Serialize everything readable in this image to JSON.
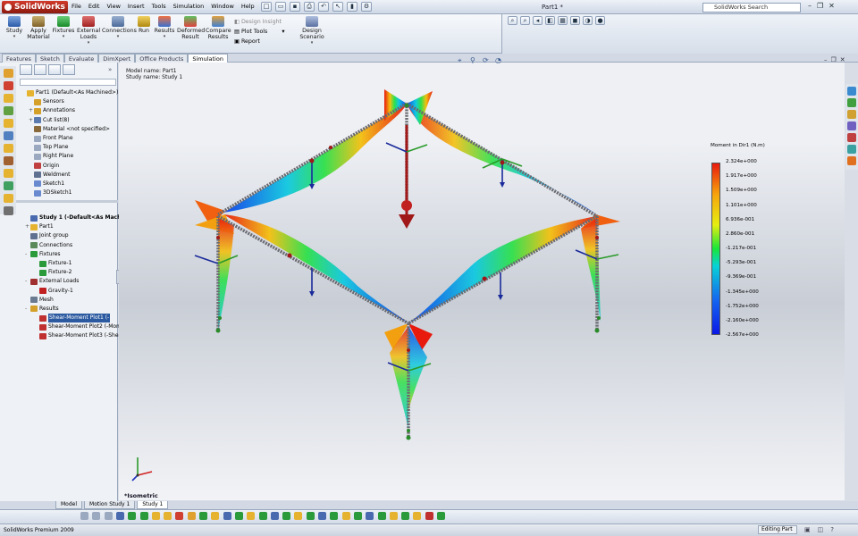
{
  "app": {
    "logo": "SolidWorks",
    "document_title": "Part1 *",
    "search_placeholder": "SolidWorks Search"
  },
  "menu": [
    "File",
    "Edit",
    "View",
    "Insert",
    "Tools",
    "Simulation",
    "Window",
    "Help"
  ],
  "command_manager": {
    "study": "Study",
    "apply_material": "Apply Material",
    "fixtures": "Fixtures",
    "external_loads": "External Loads",
    "connections": "Connections",
    "run": "Run",
    "results": "Results",
    "deformed_result": "Deformed Result",
    "compare_results": "Compare Results",
    "design_insight": "Design Insight",
    "plot_tools": "Plot Tools",
    "report": "Report",
    "design_scenario": "Design Scenario"
  },
  "tabs": [
    "Features",
    "Sketch",
    "Evaluate",
    "DimXpert",
    "Office Products",
    "Simulation"
  ],
  "active_tab": "Simulation",
  "feature_tree": [
    {
      "label": "Part1  (Default<As Machined>)",
      "expander": "",
      "icon": "#e6b330"
    },
    {
      "label": "Sensors",
      "expander": "",
      "icon": "#d4a02a"
    },
    {
      "label": "Annotations",
      "expander": "+",
      "icon": "#d4a02a"
    },
    {
      "label": "Cut list(8)",
      "expander": "+",
      "icon": "#5a7ab0"
    },
    {
      "label": "Material <not specified>",
      "expander": "",
      "icon": "#8a6a3a"
    },
    {
      "label": "Front Plane",
      "expander": "",
      "icon": "#9aa8c0"
    },
    {
      "label": "Top Plane",
      "expander": "",
      "icon": "#9aa8c0"
    },
    {
      "label": "Right Plane",
      "expander": "",
      "icon": "#9aa8c0"
    },
    {
      "label": "Origin",
      "expander": "",
      "icon": "#c04040"
    },
    {
      "label": "Weldment",
      "expander": "",
      "icon": "#607090"
    },
    {
      "label": "Sketch1",
      "expander": "",
      "icon": "#6a8ad0"
    },
    {
      "label": "3DSketch1",
      "expander": "",
      "icon": "#6a8ad0"
    }
  ],
  "study_tree": [
    {
      "label": "Study 1 (-Default<As Machine",
      "expander": "",
      "icon": "#4a6ab0",
      "bold": true
    },
    {
      "label": "Part1",
      "expander": "+",
      "icon": "#e6b330"
    },
    {
      "label": "Joint group",
      "expander": "",
      "icon": "#607090"
    },
    {
      "label": "Connections",
      "expander": "",
      "icon": "#5a8a5a"
    },
    {
      "label": "Fixtures",
      "expander": "-",
      "icon": "#2a9a3a"
    },
    {
      "label": "Fixture-1",
      "expander": "",
      "icon": "#2a9a3a"
    },
    {
      "label": "Fixture-2",
      "expander": "",
      "icon": "#2a9a3a"
    },
    {
      "label": "External Loads",
      "expander": "-",
      "icon": "#a03030"
    },
    {
      "label": "Gravity-1",
      "expander": "",
      "icon": "#c02020"
    },
    {
      "label": "Mesh",
      "expander": "",
      "icon": "#6a7a90"
    },
    {
      "label": "Results",
      "expander": "-",
      "icon": "#d4a02a"
    },
    {
      "label": "Shear-Moment Plot1 (-",
      "expander": "",
      "icon": "#c03030",
      "selected": true
    },
    {
      "label": "Shear-Moment Plot2 (-Mom",
      "expander": "",
      "icon": "#c03030"
    },
    {
      "label": "Shear-Moment Plot3 (-Shea",
      "expander": "",
      "icon": "#c03030"
    }
  ],
  "viewport": {
    "model_name": "Model name: Part1",
    "study_name": "Study name: Study 1",
    "view_label": "*Isometric"
  },
  "legend": {
    "title": "Moment in Dir1 (N.m)",
    "values": [
      "2.324e+000",
      "1.917e+000",
      "1.509e+000",
      "1.101e+000",
      "6.936e-001",
      "2.860e-001",
      "-1.217e-001",
      "-5.293e-001",
      "-9.369e-001",
      "-1.345e+000",
      "-1.752e+000",
      "-2.160e+000",
      "-2.567e+000"
    ]
  },
  "bottom_tabs": [
    "Model",
    "Motion Study 1",
    "Study 1"
  ],
  "active_bottom_tab": "Study 1",
  "status": {
    "left": "SolidWorks Premium 2009",
    "mode": "Editing Part"
  }
}
